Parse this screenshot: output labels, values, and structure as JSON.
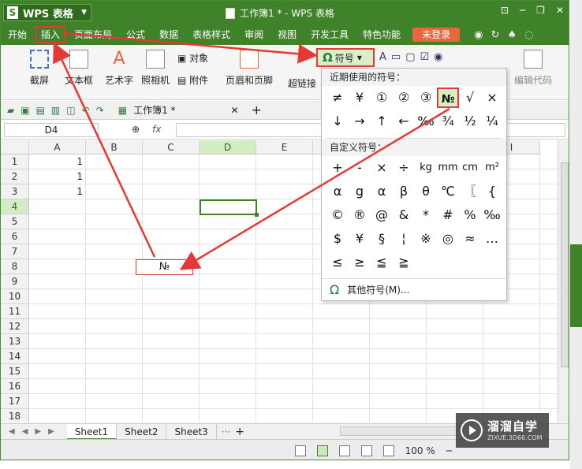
{
  "window": {
    "brand": "WPS 表格",
    "brand_logo": "S",
    "title": "工作簿1 * - WPS 表格"
  },
  "menu": {
    "items": [
      "开始",
      "插入",
      "页面布局",
      "公式",
      "数据",
      "表格样式",
      "审阅",
      "视图",
      "开发工具",
      "特色功能"
    ],
    "login": "未登录"
  },
  "ribbon": {
    "screenshot": "截屏",
    "textbox": "文本框",
    "wordart": "艺术字",
    "camera": "照相机",
    "object": "对象",
    "attachment": "附件",
    "header_footer": "页眉和页脚",
    "hyperlink": "超链接",
    "symbol": "符号",
    "edit_code": "编辑代码"
  },
  "tabs": {
    "doc": "工作簿1 *"
  },
  "formula": {
    "cell_ref": "D4",
    "fx": "fx",
    "value": ""
  },
  "sheet": {
    "columns": [
      "A",
      "B",
      "C",
      "D",
      "E",
      "F",
      "G",
      "H",
      "I"
    ],
    "rows": [
      "1",
      "2",
      "3",
      "4",
      "5",
      "6",
      "7",
      "8",
      "9",
      "10",
      "11",
      "12",
      "13",
      "14",
      "15",
      "16",
      "17",
      "18"
    ],
    "cells": [
      {
        "ref": "A1",
        "value": "1"
      },
      {
        "ref": "A2",
        "value": "1"
      },
      {
        "ref": "A3",
        "value": "1"
      }
    ],
    "callout": "№",
    "tabs": [
      "Sheet1",
      "Sheet2",
      "Sheet3"
    ],
    "more": "···",
    "add": "+"
  },
  "status": {
    "zoom": "100 %"
  },
  "symbols": {
    "recent_header": "近期使用的符号：",
    "recent": [
      [
        "≠",
        "¥",
        "①",
        "②",
        "③",
        "№",
        "√",
        "×"
      ],
      [
        "↓",
        "→",
        "↑",
        "←",
        "‰",
        "¾",
        "½",
        "¼"
      ]
    ],
    "custom_header": "自定义符号：",
    "custom": [
      [
        "+",
        "-",
        "×",
        "÷",
        "kg",
        "mm",
        "cm",
        "m²"
      ],
      [
        "α",
        "g",
        "α",
        "β",
        "θ",
        "℃",
        "〖",
        "{"
      ],
      [
        "©",
        "®",
        "@",
        "&",
        "*",
        "#",
        "%",
        "‰"
      ],
      [
        "$",
        "¥",
        "§",
        "¦",
        "※",
        "◎",
        "≈",
        "…"
      ],
      [
        "≤",
        "≥",
        "≦",
        "≧"
      ]
    ],
    "more": "其他符号(M)..."
  },
  "watermark": {
    "name": "溜溜自学",
    "url": "ZIXUE.3D66.COM"
  }
}
